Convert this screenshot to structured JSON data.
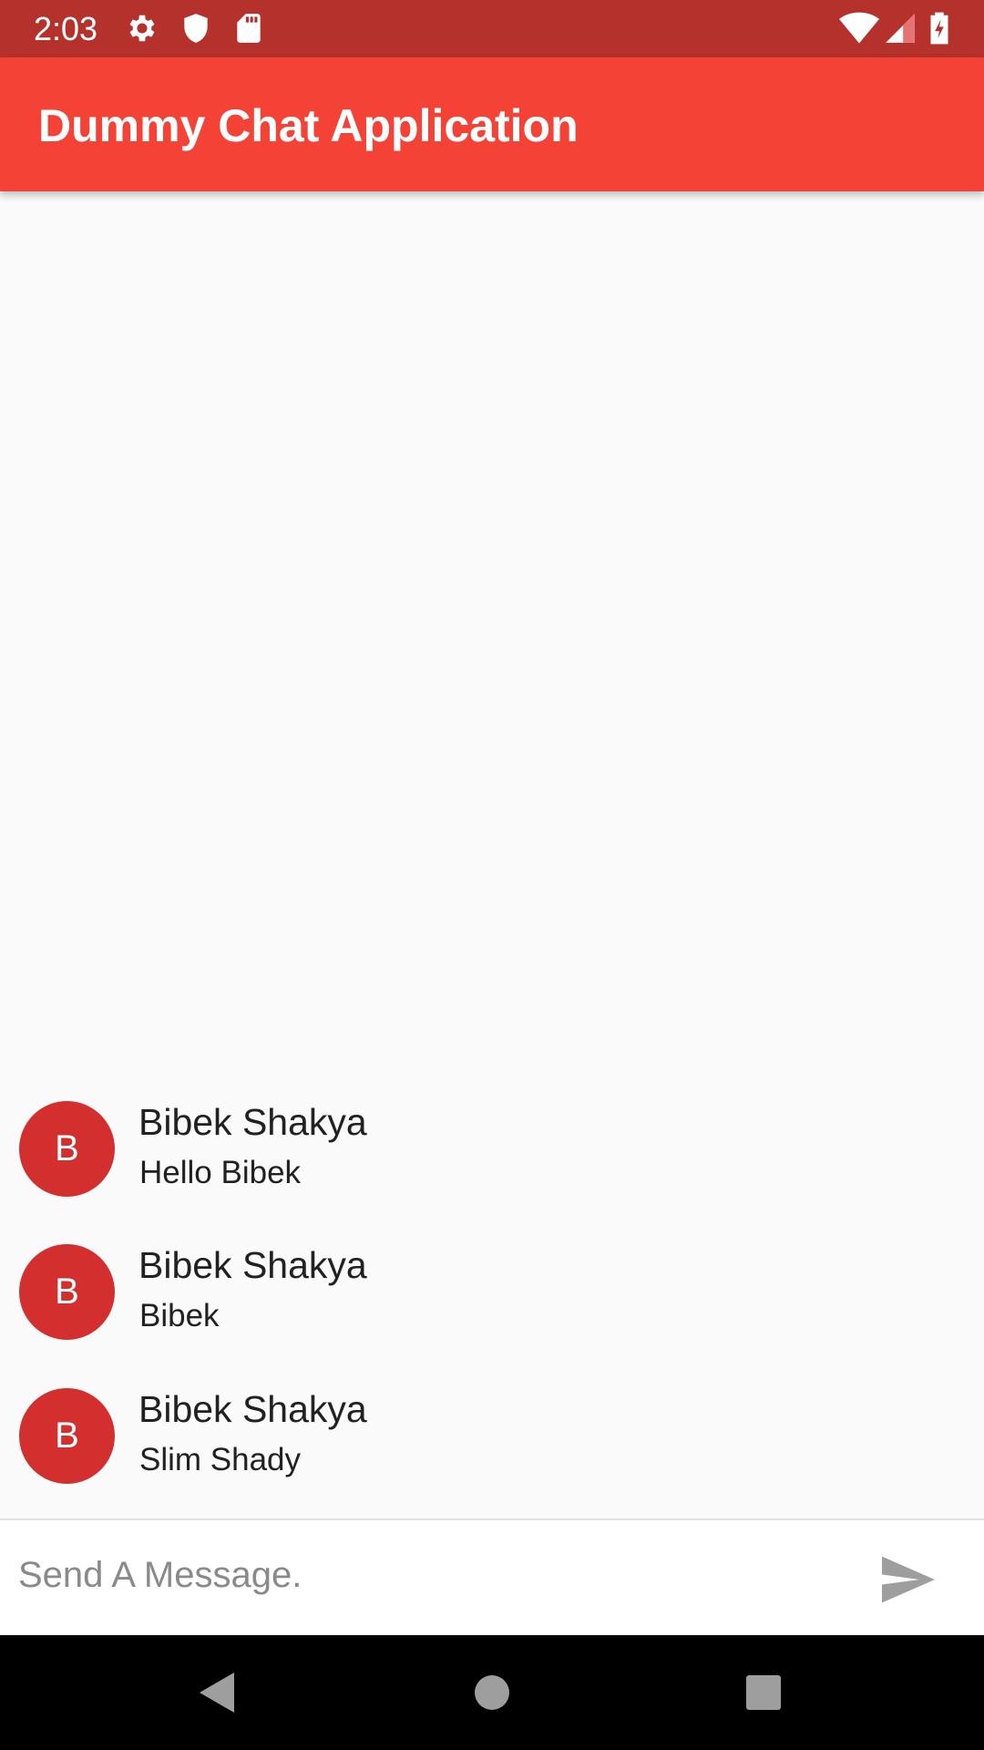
{
  "status_bar": {
    "time": "2:03",
    "icons": [
      "gear-icon",
      "shield-icon",
      "sd-card-icon",
      "wifi-icon",
      "signal-icon",
      "battery-charging-icon"
    ]
  },
  "app_bar": {
    "title": "Dummy Chat Application",
    "color": "#f44336"
  },
  "messages": [
    {
      "avatar_letter": "B",
      "name": "Bibek Shakya",
      "text": "Hello Bibek"
    },
    {
      "avatar_letter": "B",
      "name": "Bibek Shakya",
      "text": "Bibek"
    },
    {
      "avatar_letter": "B",
      "name": "Bibek Shakya",
      "text": "Slim Shady"
    }
  ],
  "composer": {
    "placeholder": "Send A Message.",
    "value": "",
    "send_icon": "send-icon"
  },
  "nav_bar": {
    "icons": [
      "back-icon",
      "home-icon",
      "recents-icon"
    ]
  },
  "colors": {
    "status_bar": "#b5312b",
    "app_bar": "#f44336",
    "avatar": "#d32f2f",
    "background": "#fafafa"
  }
}
